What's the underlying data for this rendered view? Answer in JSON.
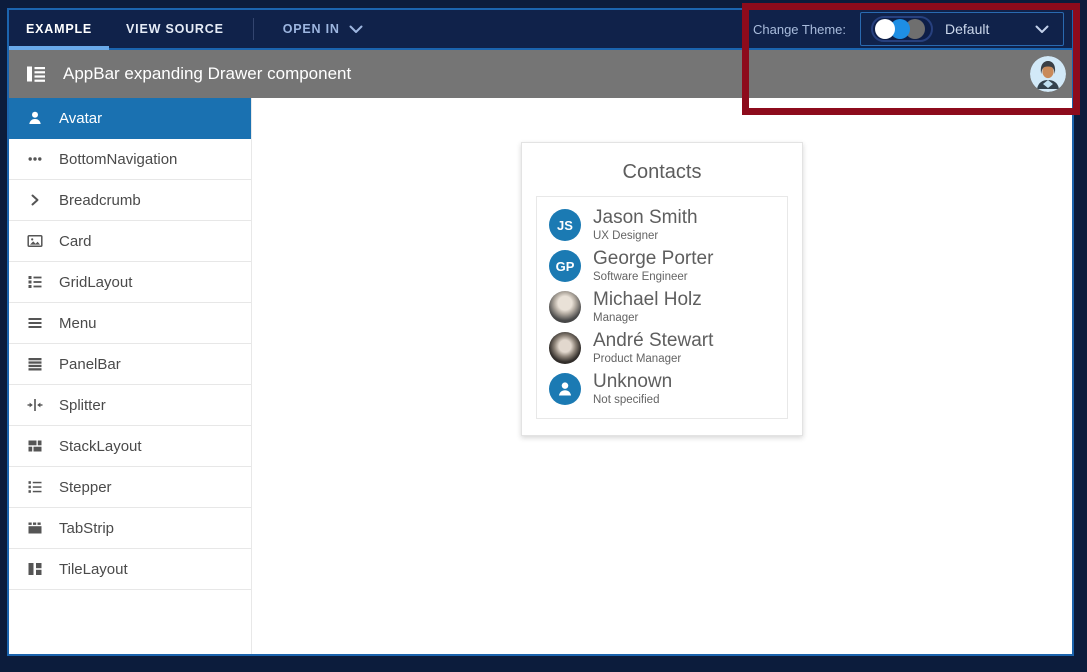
{
  "topbar": {
    "tabs": [
      {
        "label": "EXAMPLE",
        "active": true
      },
      {
        "label": "VIEW SOURCE",
        "active": false
      },
      {
        "label": "OPEN IN",
        "active": false
      }
    ],
    "change_theme_label": "Change Theme:",
    "theme_select": {
      "value": "Default",
      "toggle_colors": [
        "#ffffff",
        "#1e8ee4",
        "#6f6f6f"
      ]
    }
  },
  "appbar": {
    "title": "AppBar expanding Drawer component",
    "menu_icon": "drawer-menu-icon",
    "user_avatar_icon": "user-avatar-illustration"
  },
  "drawer": {
    "items": [
      {
        "label": "Avatar",
        "icon": "avatar-icon",
        "selected": true
      },
      {
        "label": "BottomNavigation",
        "icon": "bottom-navigation-icon",
        "selected": false
      },
      {
        "label": "Breadcrumb",
        "icon": "breadcrumb-icon",
        "selected": false
      },
      {
        "label": "Card",
        "icon": "card-icon",
        "selected": false
      },
      {
        "label": "GridLayout",
        "icon": "grid-layout-icon",
        "selected": false
      },
      {
        "label": "Menu",
        "icon": "menu-icon",
        "selected": false
      },
      {
        "label": "PanelBar",
        "icon": "panelbar-icon",
        "selected": false
      },
      {
        "label": "Splitter",
        "icon": "splitter-icon",
        "selected": false
      },
      {
        "label": "StackLayout",
        "icon": "stack-layout-icon",
        "selected": false
      },
      {
        "label": "Stepper",
        "icon": "stepper-icon",
        "selected": false
      },
      {
        "label": "TabStrip",
        "icon": "tab-strip-icon",
        "selected": false
      },
      {
        "label": "TileLayout",
        "icon": "tile-layout-icon",
        "selected": false
      }
    ]
  },
  "card": {
    "title": "Contacts",
    "contacts": [
      {
        "name": "Jason Smith",
        "role": "UX Designer",
        "initials": "JS",
        "avatar": "initials"
      },
      {
        "name": "George Porter",
        "role": "Software Engineer",
        "initials": "GP",
        "avatar": "initials"
      },
      {
        "name": "Michael Holz",
        "role": "Manager",
        "avatar": "photo"
      },
      {
        "name": "André Stewart",
        "role": "Product Manager",
        "avatar": "photo"
      },
      {
        "name": "Unknown",
        "role": "Not specified",
        "avatar": "person-icon"
      }
    ]
  },
  "colors": {
    "topbar_bg": "#10224a",
    "frame_border_blue": "#1b64ae",
    "active_tab_underline": "#69a9ea",
    "appbar_bg": "#757575",
    "drawer_selected_bg": "#1a71b1",
    "avatar_blue": "#1b7ab3",
    "annotation_red": "#8d0b1c"
  }
}
